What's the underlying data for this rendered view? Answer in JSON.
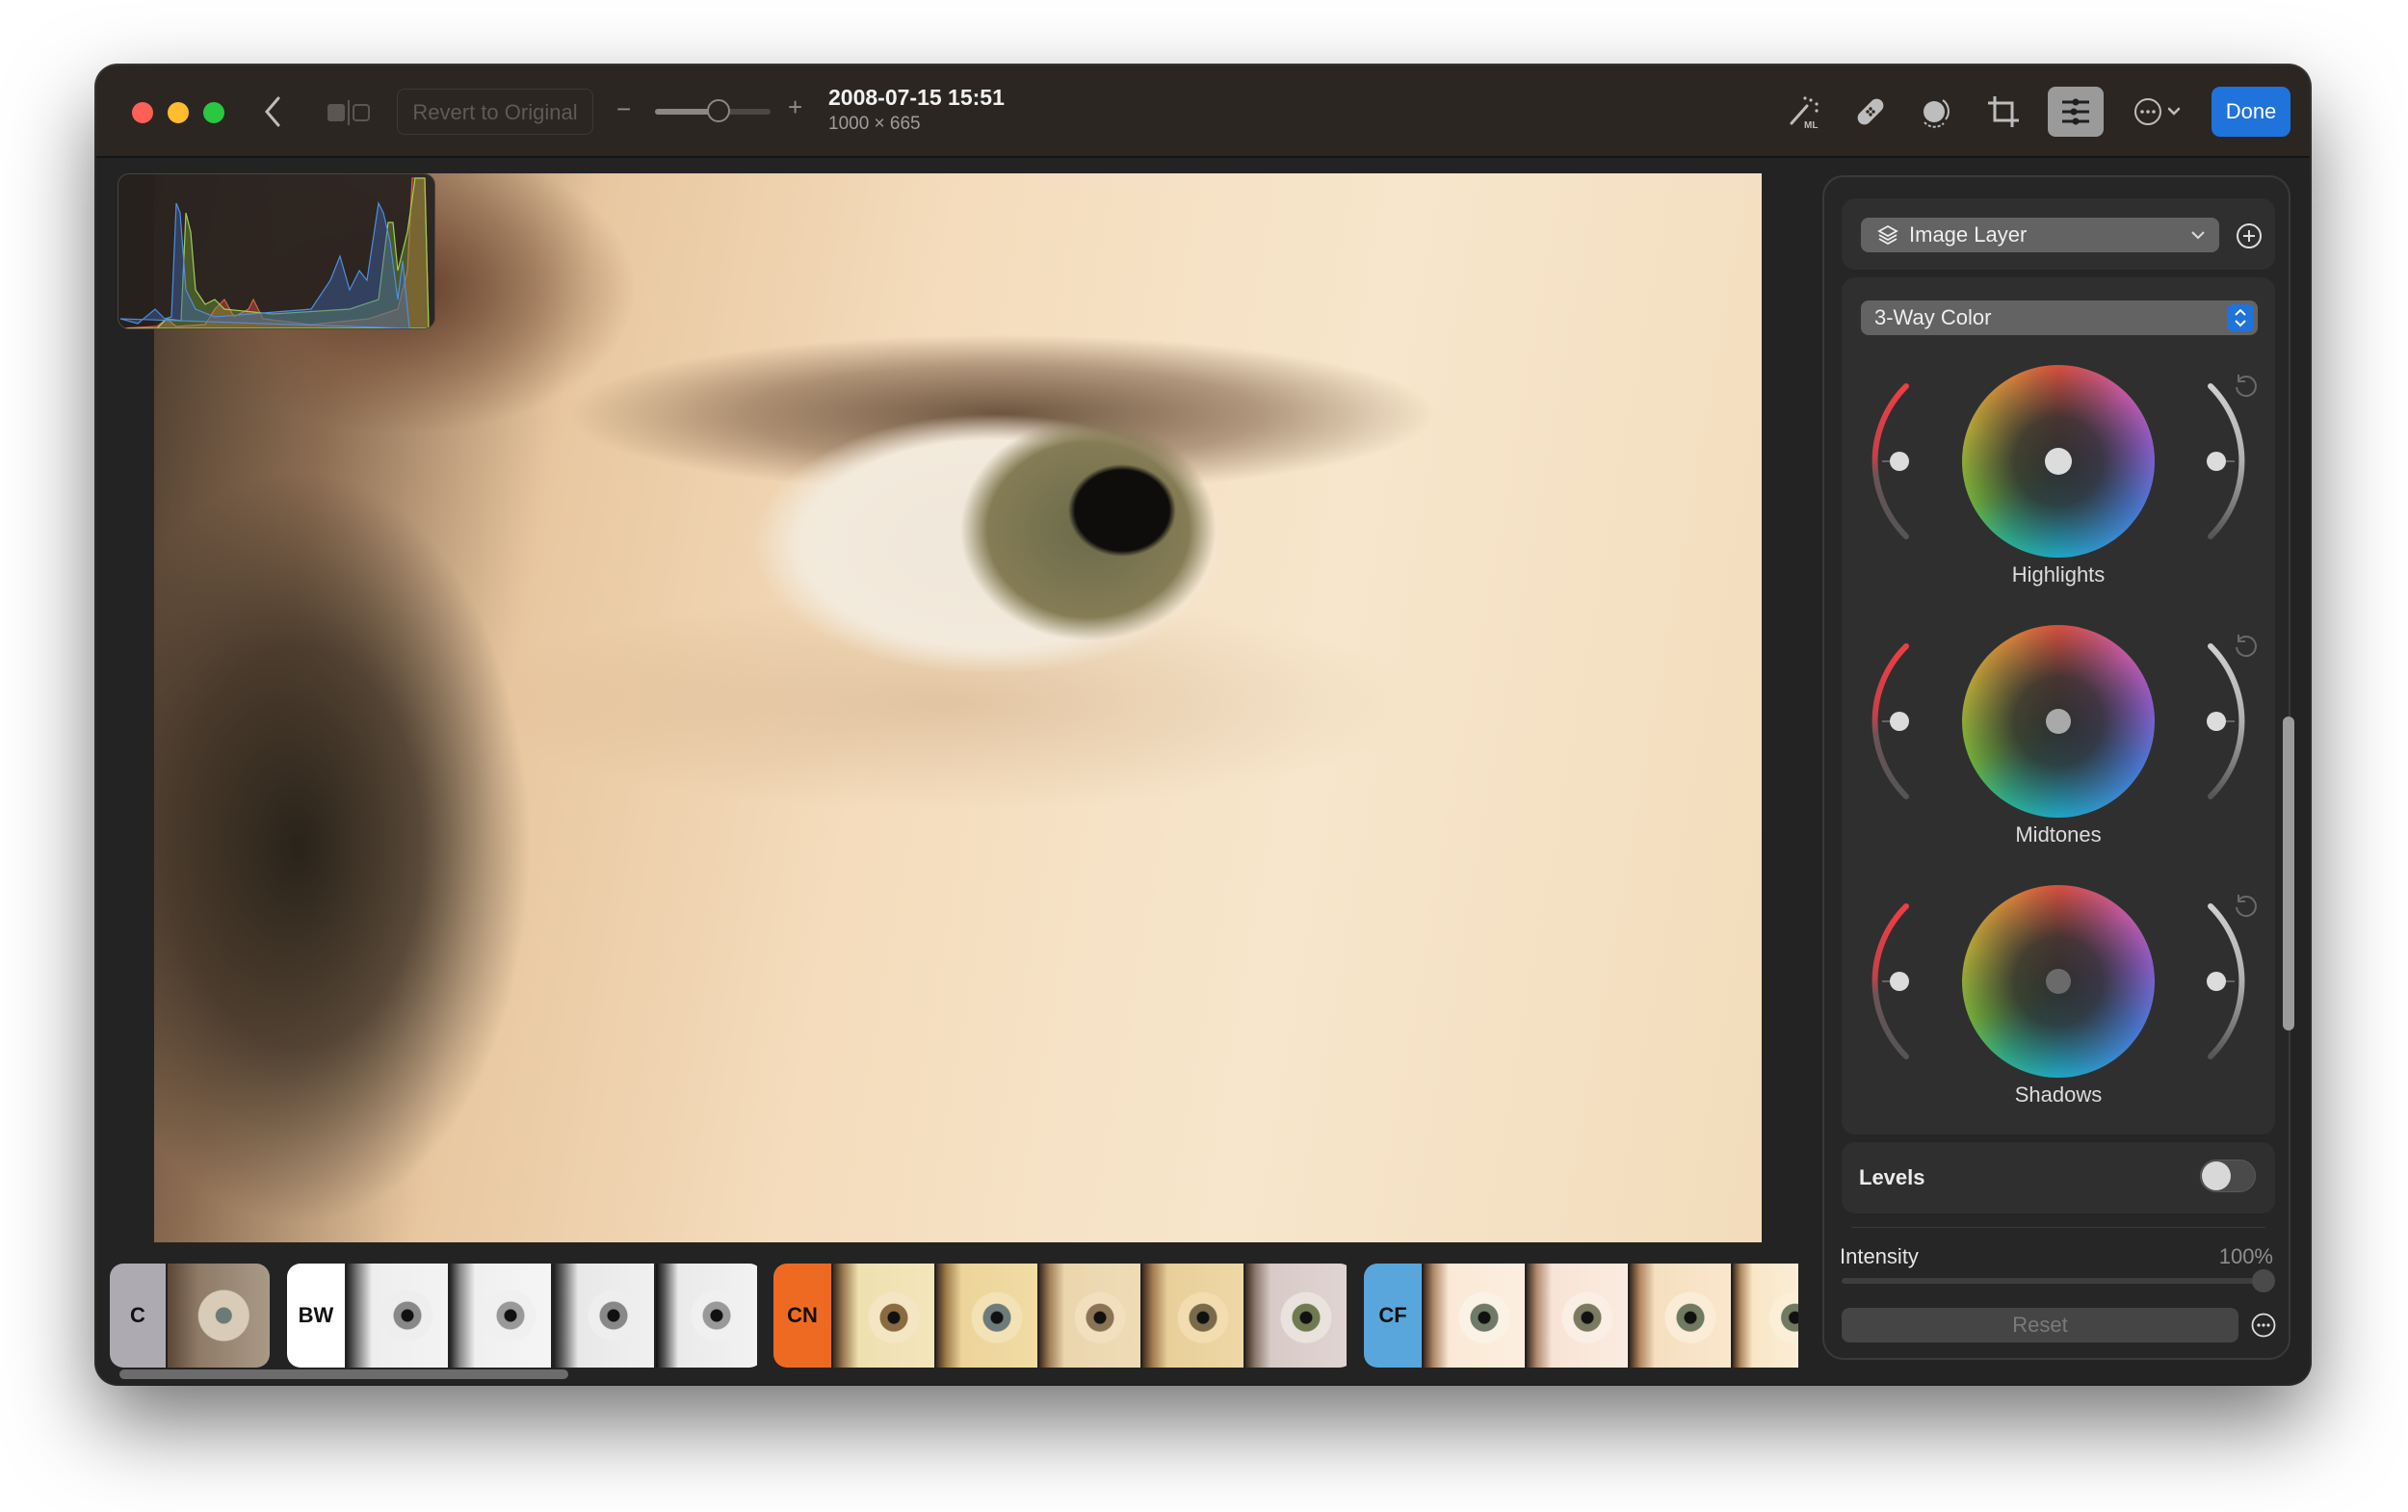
{
  "window": {
    "title": "2008-07-15 15:51",
    "subtitle": "1000 × 665"
  },
  "toolbar": {
    "back_icon": "chevron-left-icon",
    "compare_icon": "split-compare-icon",
    "revert_label": "Revert to Original",
    "zoom_minus": "−",
    "zoom_plus": "+",
    "zoom_level_fraction": 0.55,
    "tools": [
      {
        "name": "ml-enhance",
        "icon": "magic-wand-ml-icon",
        "active": false
      },
      {
        "name": "retouch",
        "icon": "bandage-icon",
        "active": false
      },
      {
        "name": "effects",
        "icon": "rotate-circle-icon",
        "active": false
      },
      {
        "name": "crop",
        "icon": "crop-icon",
        "active": false
      },
      {
        "name": "adjust",
        "icon": "sliders-icon",
        "active": true
      },
      {
        "name": "more",
        "icon": "ellipsis-circle-icon",
        "active": false
      }
    ],
    "done_label": "Done",
    "accent_color": "#1f73db"
  },
  "filmstrip": {
    "groups": [
      {
        "tag": "C",
        "tag_color": "#aeaab2",
        "thumbs": 1
      },
      {
        "tag": "BW",
        "tag_color": "#ffffff",
        "thumbs": 4
      },
      {
        "tag": "CN",
        "tag_color": "#ee6a22",
        "thumbs": 5
      },
      {
        "tag": "CF",
        "tag_color": "#58a6dc",
        "thumbs": 4
      }
    ]
  },
  "panel": {
    "layer_dropdown": "Image Layer",
    "adjustment_dropdown": "3-Way Color",
    "wheels": [
      {
        "label": "Highlights"
      },
      {
        "label": "Midtones"
      },
      {
        "label": "Shadows"
      }
    ],
    "levels_label": "Levels",
    "levels_enabled": false,
    "intensity_label": "Intensity",
    "intensity_value": "100%",
    "intensity_fraction": 1.0,
    "reset_label": "Reset"
  }
}
